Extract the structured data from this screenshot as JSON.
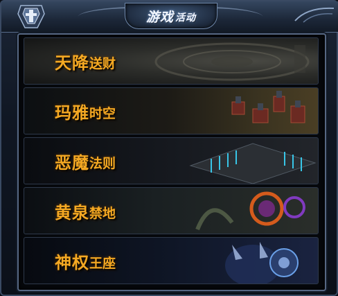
{
  "header": {
    "title_big": "游戏",
    "title_small": "活动"
  },
  "events": [
    {
      "name_big": "天降",
      "name_small": "送财"
    },
    {
      "name_big": "玛雅",
      "name_small": "时空"
    },
    {
      "name_big": "恶魔",
      "name_small": "法则"
    },
    {
      "name_big": "黄泉",
      "name_small": "禁地"
    },
    {
      "name_big": "神权",
      "name_small": "王座"
    }
  ],
  "colors": {
    "label": "#f5a923",
    "frame": "#566783",
    "header": "#34465f"
  },
  "icons": [
    "armor-emblem-icon",
    "ornament-icon"
  ]
}
